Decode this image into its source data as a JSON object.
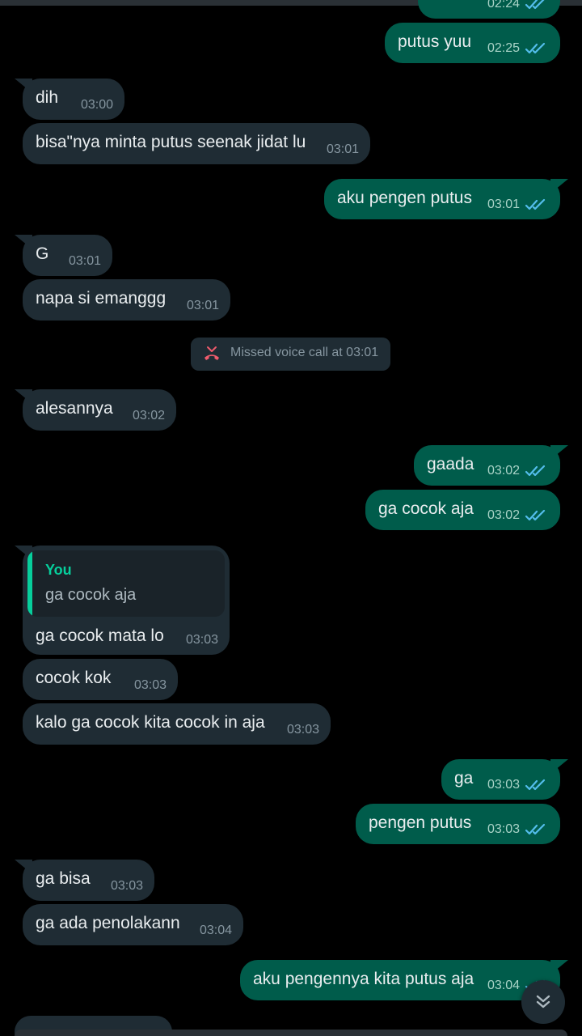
{
  "chat": {
    "top_partial": {
      "time": "02:24"
    },
    "messages": [
      {
        "dir": "out",
        "text": "putus yuu",
        "time": "02:25"
      },
      {
        "dir": "in",
        "text": "dih",
        "time": "03:00"
      },
      {
        "dir": "in",
        "text": "bisa\"nya minta putus seenak jidat lu",
        "time": "03:01"
      },
      {
        "dir": "out",
        "text": "aku pengen putus",
        "time": "03:01"
      },
      {
        "dir": "in",
        "text": "G",
        "time": "03:01"
      },
      {
        "dir": "in",
        "text": "napa si emanggg",
        "time": "03:01"
      },
      {
        "dir": "in",
        "text": "alesannya",
        "time": "03:02"
      },
      {
        "dir": "out",
        "text": "gaada",
        "time": "03:02"
      },
      {
        "dir": "out",
        "text": "ga cocok aja",
        "time": "03:02"
      },
      {
        "dir": "in",
        "text": "ga cocok mata lo",
        "time": "03:03"
      },
      {
        "dir": "in",
        "text": "cocok kok",
        "time": "03:03"
      },
      {
        "dir": "in",
        "text": "kalo ga cocok kita cocok in aja",
        "time": "03:03"
      },
      {
        "dir": "out",
        "text": "ga",
        "time": "03:03"
      },
      {
        "dir": "out",
        "text": "pengen putus",
        "time": "03:03"
      },
      {
        "dir": "in",
        "text": "ga bisa",
        "time": "03:03"
      },
      {
        "dir": "in",
        "text": "ga ada penolakann",
        "time": "03:04"
      },
      {
        "dir": "out",
        "text": "aku pengennya kita putus aja",
        "time": "03:04"
      }
    ],
    "reply_quote": {
      "author": "You",
      "text": "ga cocok aja"
    },
    "system_message": {
      "text": "Missed voice call at 03:01",
      "icon": "missed-call-icon"
    },
    "scroll_button": {
      "icon": "double-chevron-down-icon"
    }
  },
  "colors": {
    "background": "#000000",
    "incoming_bubble": "#1f2c34",
    "outgoing_bubble": "#005c4b",
    "read_ticks": "#53bdeb",
    "missed_call": "#f15c6d",
    "quote_accent": "#06cf9c"
  }
}
